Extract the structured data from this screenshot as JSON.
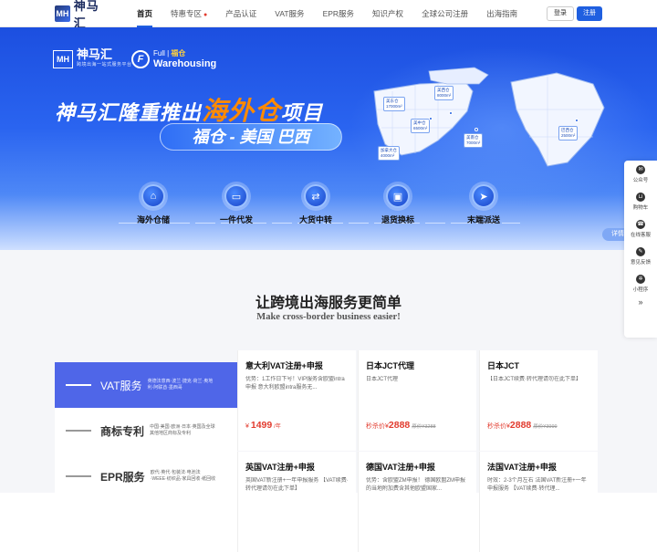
{
  "nav": {
    "logo_mark": "MH",
    "logo_text": "神马汇",
    "items": [
      {
        "label": "首页"
      },
      {
        "label": "特惠专区"
      },
      {
        "label": "产品认证"
      },
      {
        "label": "VAT服务"
      },
      {
        "label": "EPR服务"
      },
      {
        "label": "知识产权"
      },
      {
        "label": "全球公司注册"
      },
      {
        "label": "出海指南"
      }
    ],
    "hot_icon": "fire-icon",
    "login": "登录",
    "register": "注册"
  },
  "banner": {
    "logo1": {
      "mark": "MH",
      "name": "神马汇",
      "tagline": "跨境出海一站式服务平台"
    },
    "logo2": {
      "mark": "F",
      "top_a": "Full",
      "top_b": "福仓",
      "bottom": "Warehousing"
    },
    "headline_a": "神马汇隆重推出",
    "headline_b": "海外仓",
    "headline_c": "项目",
    "subhead": "福仓 - 美国 巴西",
    "map_cards": [
      {
        "name": "美东仓",
        "size": "17000m²"
      },
      {
        "name": "美西仓",
        "size": "8000m²"
      },
      {
        "name": "美中仓",
        "size": "6500m²"
      },
      {
        "name": "美南仓",
        "size": "7000m²"
      },
      {
        "name": "加拿大仓",
        "size": "4000m²"
      },
      {
        "name": "巴西仓",
        "size": "2500m²"
      }
    ],
    "services": [
      {
        "label": "海外仓储",
        "icon": "warehouse-icon"
      },
      {
        "label": "一件代发",
        "icon": "truck-icon"
      },
      {
        "label": "大货中转",
        "icon": "transfer-icon"
      },
      {
        "label": "退货换标",
        "icon": "box-icon"
      },
      {
        "label": "末端派送",
        "icon": "delivery-icon"
      }
    ],
    "detail_label": "详情"
  },
  "float": [
    {
      "label": "公众号",
      "icon": "wechat-icon"
    },
    {
      "label": "购物车",
      "icon": "cart-icon"
    },
    {
      "label": "在线客服",
      "icon": "service-icon"
    },
    {
      "label": "意见反馈",
      "icon": "feedback-icon"
    },
    {
      "label": "小程序",
      "icon": "miniapp-icon"
    }
  ],
  "section": {
    "title": "让跨境出海服务更简单",
    "subtitle": "Make cross-border business easier!",
    "tabs": [
      {
        "name": "VAT服务",
        "desc": "英德法意西·波兰·捷克·荷兰·奥地利·阿联酋·墨西哥"
      },
      {
        "name": "商标专利",
        "desc": "中国·美国·欧洲·日本·英国及全球其他地区商标及专利"
      },
      {
        "name": "EPR服务",
        "desc": "欧代·英代·包装法·电池法·WEEE·纺织品·家具回收·纸回收"
      }
    ],
    "cards": [
      {
        "title": "意大利VAT注册+申报",
        "desc": "优势：1工作日下号！VIP服务含欧盟intra申报 意大利欧盟intra服务无...",
        "prefix": "¥",
        "price": "1499",
        "unit": "/年",
        "old": ""
      },
      {
        "title": "日本JCT代理",
        "desc": "日本JCT代理",
        "prefix": "秒杀价¥",
        "price": "2888",
        "unit": "",
        "old": "原价¥3288"
      },
      {
        "title": "日本JCT",
        "desc": "【日本JCT续费·转代理请勿在此下单】",
        "prefix": "秒杀价¥",
        "price": "2888",
        "unit": "",
        "old": "原价¥3999"
      },
      {
        "title": "英国VAT注册+申报",
        "desc": "英国VAT新注册+一年申报服务 【VAT续费·转代理请勿在此下单】",
        "prefix": "",
        "price": "",
        "unit": "",
        "old": ""
      },
      {
        "title": "德国VAT注册+申报",
        "desc": "优势：含欧盟ZM申报！ 德国欧盟ZM申报的当地附加费含其他欧盟国家...",
        "prefix": "",
        "price": "",
        "unit": "",
        "old": ""
      },
      {
        "title": "法国VAT注册+申报",
        "desc": "时效：2-3个月左右 法国VAT新注册+一年申报服务 【VAT续费·转代理...",
        "prefix": "",
        "price": "",
        "unit": "",
        "old": ""
      }
    ]
  }
}
